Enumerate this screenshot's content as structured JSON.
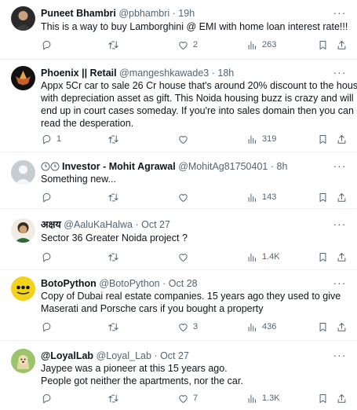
{
  "tweets": [
    {
      "name": "Puneet Bhambri",
      "handle": "@pbhambri",
      "time": "19h",
      "lines": [
        "This is a way to buy Lamborghini @ EMI with home loan interest rate!!!"
      ],
      "replies": "",
      "retweets": "",
      "likes": "2",
      "views": "263"
    },
    {
      "name": "Phoenix || Retail",
      "handle": "@mangeshkawade3",
      "time": "18h",
      "lines": [
        "Appx 5Cr car to sale 26 Cr house that's around 20% discount to the house",
        "with depreciation asset as gift. This Noida housing buzz is crazy and will",
        "end up in court cases someday. If you're into sales domain then you can",
        "read the desperation."
      ],
      "replies": "1",
      "retweets": "",
      "likes": "",
      "views": "319"
    },
    {
      "name": "Investor - Mohit Agrawal",
      "handle": "@MohitAg81750401",
      "time": "8h",
      "lines": [
        "Something new..."
      ],
      "replies": "",
      "retweets": "",
      "likes": "",
      "views": "143"
    },
    {
      "name": "अक्षय",
      "handle": "@AaluKaHalwa",
      "time": "Oct 27",
      "lines": [
        "Sector 36 Greater Noida project ?"
      ],
      "replies": "",
      "retweets": "",
      "likes": "",
      "views": "1.4K"
    },
    {
      "name": "BotoPython",
      "handle": "@BotoPython",
      "time": "Oct 28",
      "lines": [
        "Copy of Dubai real estate companies. 15 years ago they used to give",
        "Maserati and Porsche cars if you bought a property"
      ],
      "replies": "",
      "retweets": "",
      "likes": "3",
      "views": "436"
    },
    {
      "name": "@LoyalLab",
      "handle": "@Loyal_Lab",
      "time": "Oct 27",
      "lines": [
        "Jaypee was a pioneer at this 15 years ago.",
        "People got neither the apartments, nor the car."
      ],
      "replies": "",
      "retweets": "",
      "likes": "7",
      "views": "1.3K"
    }
  ],
  "separator": "·",
  "more_glyph": "···",
  "colors": {
    "text": "#0f1419",
    "secondary": "#536471",
    "border": "#eff3f4"
  },
  "icons": [
    "reply-icon",
    "retweet-icon",
    "like-icon",
    "views-icon",
    "bookmark-icon",
    "share-icon",
    "more-icon"
  ]
}
